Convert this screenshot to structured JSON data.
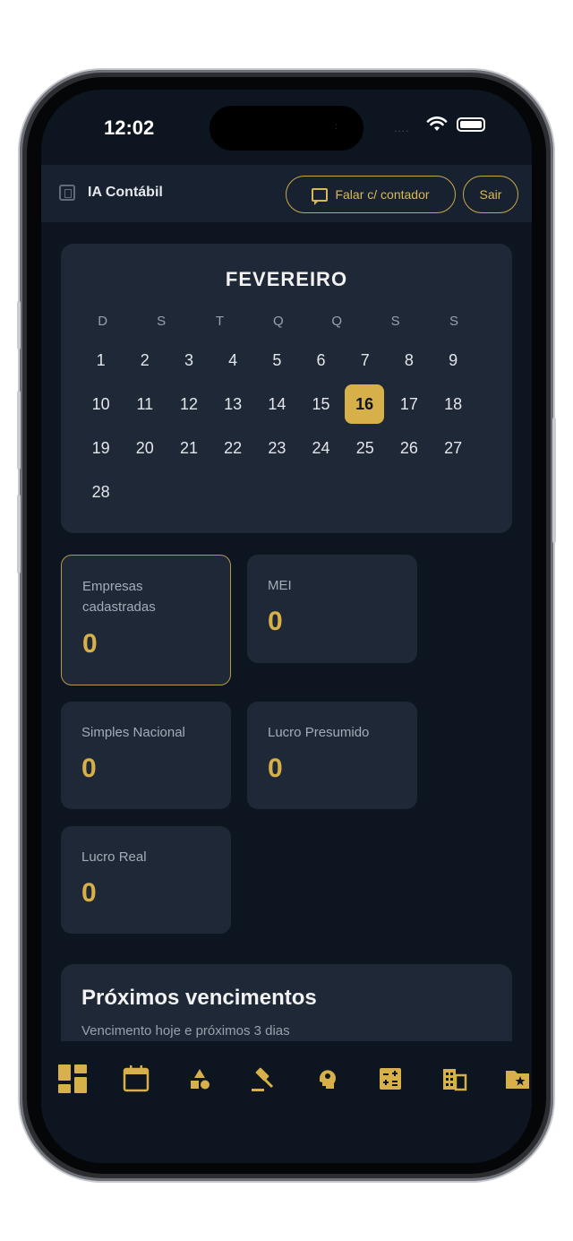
{
  "status_bar": {
    "time": "12:02",
    "island_dot": ":",
    "signal_dots": "....",
    "wifi_icon": "wifi-icon",
    "battery_icon": "battery-icon"
  },
  "header": {
    "logo_icon": "building-icon",
    "title": "IA Contábil",
    "talk_button": "Falar c/ contador",
    "talk_icon": "chat-bubble-icon",
    "exit_button": "Sair"
  },
  "calendar": {
    "month": "FEVEREIRO",
    "weekdays": [
      "D",
      "S",
      "T",
      "Q",
      "Q",
      "S",
      "S"
    ],
    "days": [
      "1",
      "2",
      "3",
      "4",
      "5",
      "6",
      "7",
      "8",
      "9",
      "10",
      "11",
      "12",
      "13",
      "14",
      "15",
      "16",
      "17",
      "18",
      "19",
      "20",
      "21",
      "22",
      "23",
      "24",
      "25",
      "26",
      "27",
      "28"
    ],
    "today": "16"
  },
  "stats": [
    {
      "label": "Empresas cadastradas",
      "value": "0"
    },
    {
      "label": "MEI",
      "value": "0"
    },
    {
      "label": "Simples Nacional",
      "value": "0"
    },
    {
      "label": "Lucro Presumido",
      "value": "0"
    },
    {
      "label": "Lucro Real",
      "value": "0"
    }
  ],
  "upcoming": {
    "title": "Próximos vencimentos",
    "subtitle": "Vencimento hoje e próximos 3 dias"
  },
  "bottom_nav": [
    {
      "icon": "dashboard-icon"
    },
    {
      "icon": "calendar-icon"
    },
    {
      "icon": "shapes-icon"
    },
    {
      "icon": "gavel-icon"
    },
    {
      "icon": "brain-icon"
    },
    {
      "icon": "calculator-icon"
    },
    {
      "icon": "buildings-icon"
    },
    {
      "icon": "folder-star-icon"
    }
  ],
  "colors": {
    "background": "#0d1520",
    "card": "#1e2836",
    "accent": "#d8b04a",
    "header": "#172130"
  }
}
